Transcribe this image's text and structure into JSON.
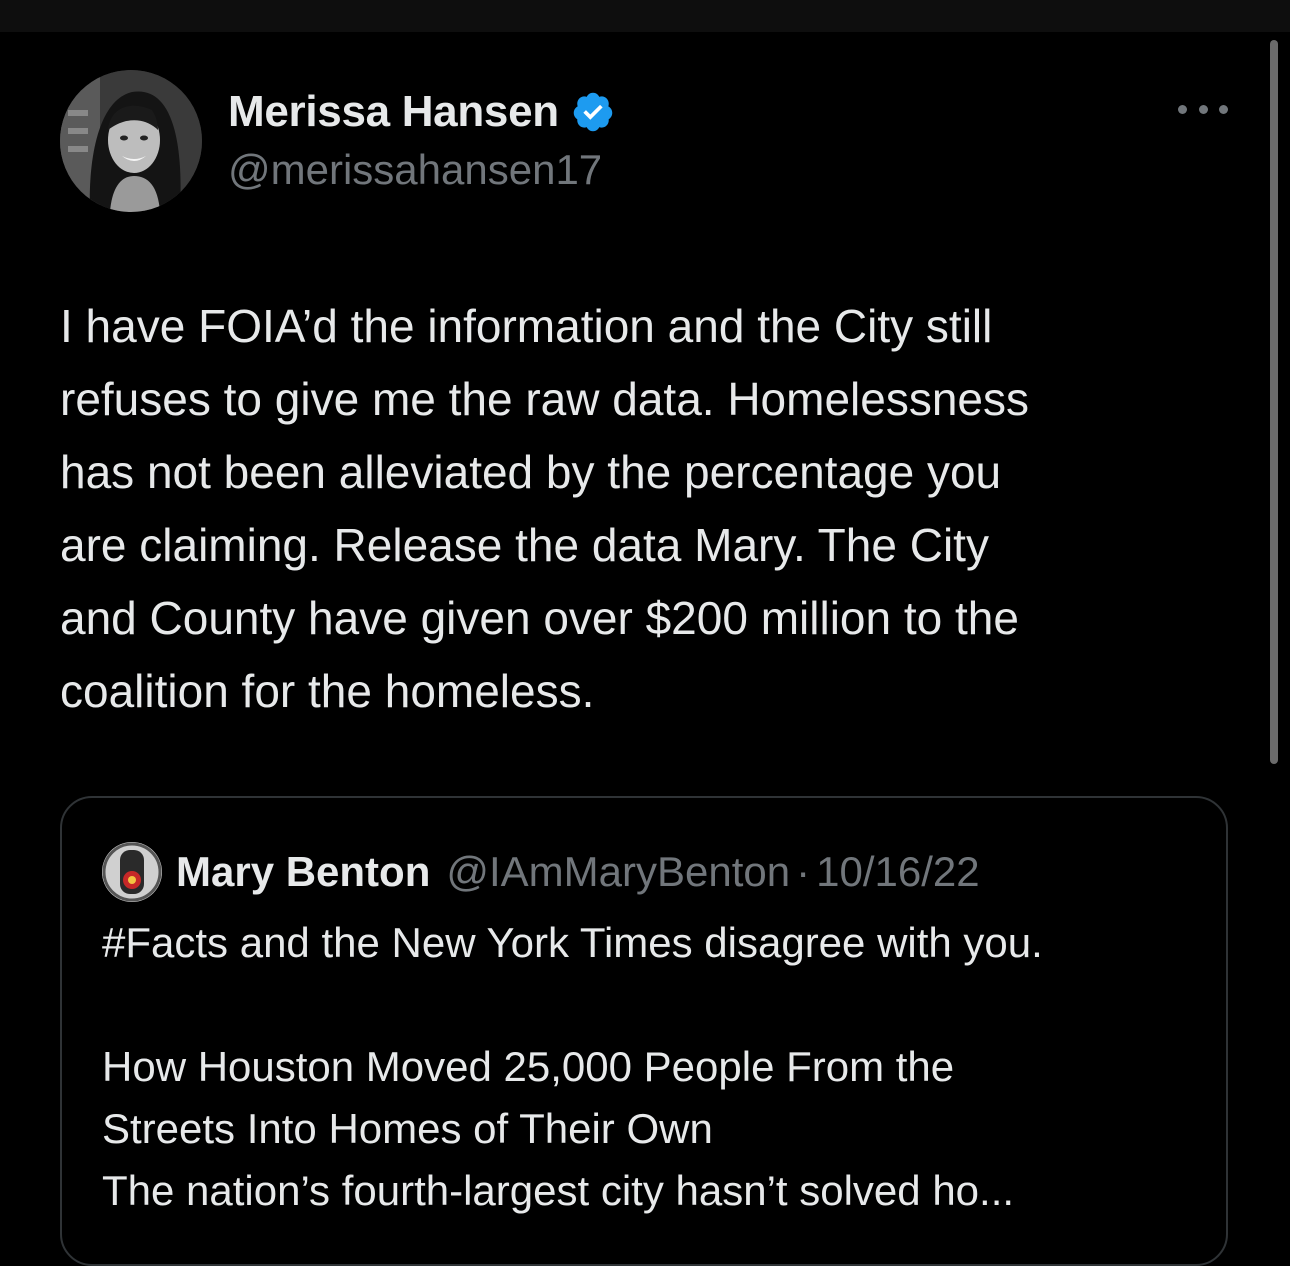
{
  "tweet": {
    "display_name": "Merissa Hansen",
    "handle": "@merissahansen17",
    "verified_icon": "verified-badge-icon",
    "more_icon": "more-options-icon",
    "text": "I have FOIA’d the information and the City still\nrefuses to give me the raw data. Homelessness\nhas not been alleviated by the percentage you\nare claiming. Release the data Mary. The City\nand County have given over $200 million to the\ncoalition for the homeless."
  },
  "quote": {
    "display_name": "Mary Benton",
    "handle": "@IAmMaryBenton",
    "separator": "·",
    "date": "10/16/22",
    "text": "#Facts and the New York Times disagree with you.",
    "headline": "How Houston Moved 25,000 People From the\nStreets Into Homes of Their Own\nThe nation’s fourth-largest city hasn’t solved ho..."
  },
  "colors": {
    "background": "#000000",
    "primary_text": "#e7e9ea",
    "secondary_text": "#71767b",
    "verified_blue": "#1d9bf0",
    "border": "#2f3336"
  }
}
